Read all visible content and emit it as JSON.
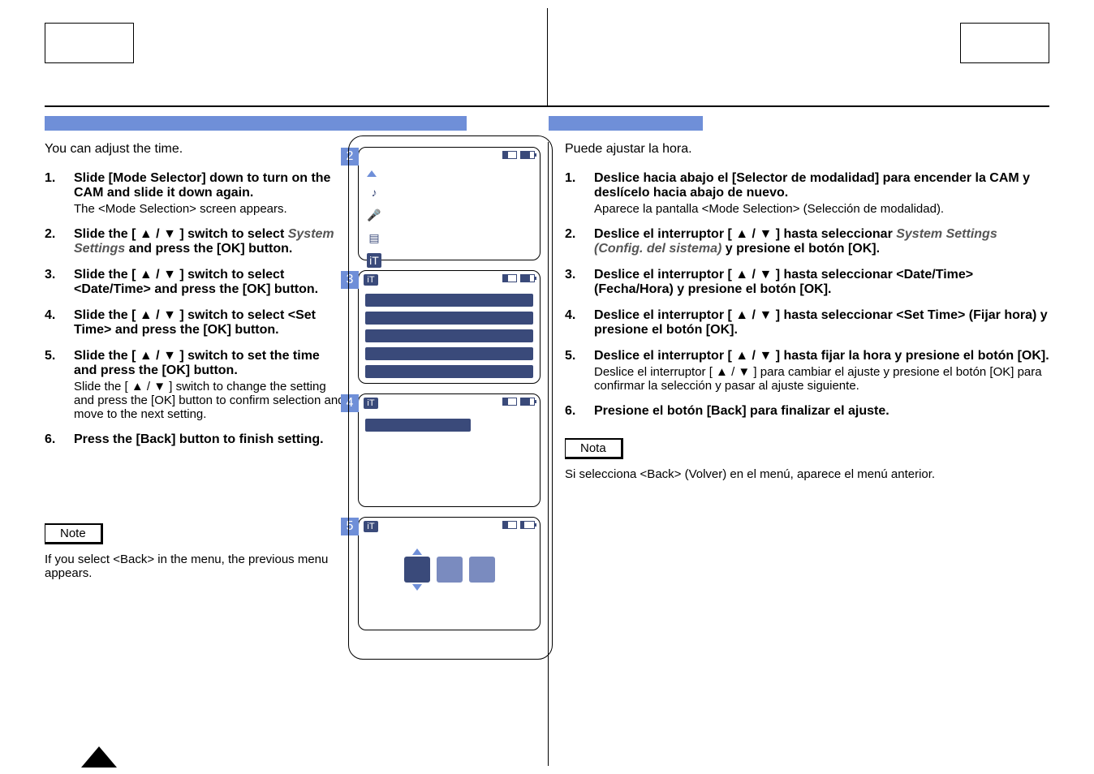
{
  "left": {
    "intro": "You can adjust the time.",
    "steps": [
      {
        "n": "1.",
        "body": "Slide [Mode Selector] down to turn on the CAM and slide it down again.",
        "sub": "The <Mode Selection> screen appears."
      },
      {
        "n": "2.",
        "body_pre": "Slide the [ ▲ / ▼ ] switch to select ",
        "body_ital": "System Settings",
        "body_post": " and press the [OK] button."
      },
      {
        "n": "3.",
        "body": "Slide the [ ▲ / ▼ ] switch to select <Date/Time> and press the [OK] button."
      },
      {
        "n": "4.",
        "body": "Slide the [ ▲ / ▼ ] switch to select <Set Time> and press the [OK] button."
      },
      {
        "n": "5.",
        "body": "Slide the [ ▲ / ▼ ] switch to set the time and press the [OK] button.",
        "sub": "Slide the [ ▲ / ▼ ] switch to change the setting and press the [OK] button to confirm selection and move to the next setting."
      },
      {
        "n": "6.",
        "body": "Press the [Back] button to finish setting."
      }
    ],
    "note_label": "Note",
    "note_text": "If you select <Back> in the menu, the previous menu appears."
  },
  "right": {
    "intro": "Puede ajustar la hora.",
    "steps": [
      {
        "n": "1.",
        "body": "Deslice hacia abajo el [Selector de modalidad] para encender la CAM y deslícelo hacia abajo de nuevo.",
        "sub": "Aparece la pantalla <Mode Selection> (Selección de modalidad)."
      },
      {
        "n": "2.",
        "body_pre": "Deslice el interruptor [ ▲ / ▼ ] hasta seleccionar ",
        "body_ital": "System Settings (Config. del sistema)",
        "body_post": " y presione el botón [OK]."
      },
      {
        "n": "3.",
        "body": "Deslice el interruptor [ ▲ / ▼ ] hasta seleccionar <Date/Time> (Fecha/Hora) y presione el botón [OK]."
      },
      {
        "n": "4.",
        "body": "Deslice el interruptor [ ▲ / ▼ ] hasta seleccionar <Set Time> (Fijar hora) y presione el botón [OK]."
      },
      {
        "n": "5.",
        "body": "Deslice el interruptor [ ▲ / ▼ ] hasta fijar la hora y presione el botón [OK].",
        "sub": "Deslice el interruptor [ ▲ / ▼ ] para cambiar el ajuste y presione el botón [OK] para confirmar la selección y pasar al ajuste siguiente."
      },
      {
        "n": "6.",
        "body": "Presione el botón [Back] para finalizar el ajuste."
      }
    ],
    "note_label": "Nota",
    "note_text": "Si selecciona <Back> (Volver) en el menú, aparece el menú anterior."
  },
  "screens": {
    "s2": "2",
    "s3": "3",
    "s4": "4",
    "s5": "5",
    "tool_glyph": "iT"
  }
}
